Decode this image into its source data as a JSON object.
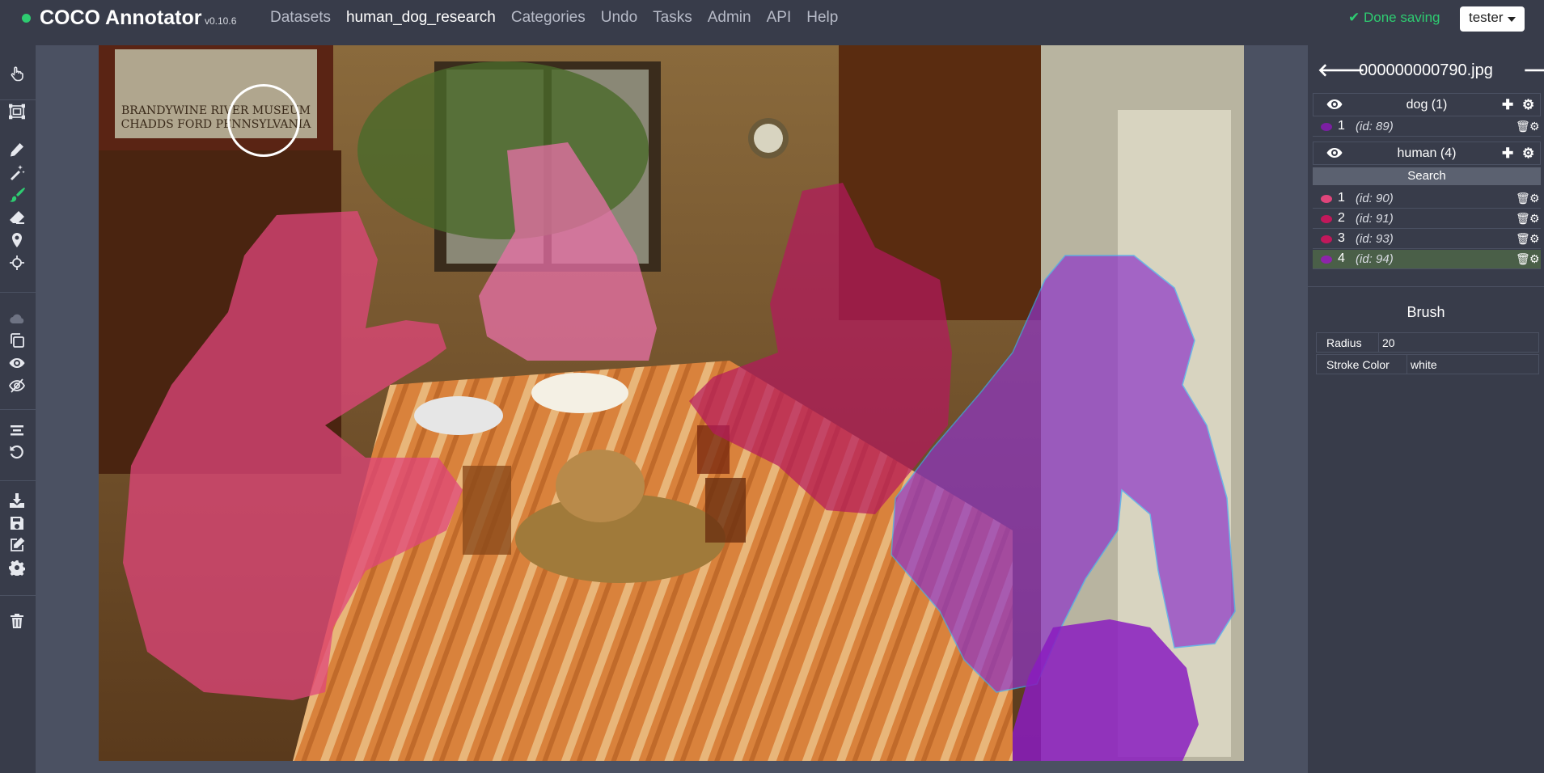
{
  "brand": {
    "name": "COCO Annotator",
    "version": "v0.10.6"
  },
  "nav": [
    "Datasets",
    "human_dog_research",
    "Categories",
    "Undo",
    "Tasks",
    "Admin",
    "API",
    "Help"
  ],
  "status": "✔ Done saving",
  "user": "tester",
  "toolbar": [
    "select-icon",
    "bbox-icon",
    "polygon-icon",
    "magic-wand-icon",
    "brush-icon",
    "eraser-icon",
    "keypoint-icon",
    "dextr-icon",
    "cloud-icon",
    "copy-icon",
    "show-all-icon",
    "hide-all-icon",
    "center-icon",
    "reset-icon",
    "download-icon",
    "save-icon",
    "edit-icon",
    "settings-icon",
    "delete-icon"
  ],
  "sidebar": {
    "file": "000000000790.jpg",
    "categories": [
      {
        "name": "dog (1)",
        "color": "#8e24aa",
        "annotations": [
          {
            "num": "1",
            "id": "(id: 89)",
            "color": "#9c27b0"
          }
        ]
      },
      {
        "name": "human (4)",
        "color": "#e91e63",
        "search": "Search",
        "annotations": [
          {
            "num": "1",
            "id": "(id: 90)",
            "color": "#e0457b"
          },
          {
            "num": "2",
            "id": "(id: 91)",
            "color": "#c2185b"
          },
          {
            "num": "3",
            "id": "(id: 93)",
            "color": "#c2185b"
          },
          {
            "num": "4",
            "id": "(id: 94)",
            "color": "#8e24aa"
          }
        ]
      }
    ],
    "tool_panel": {
      "title": "Brush",
      "radius_label": "Radius",
      "radius_value": "20",
      "stroke_label": "Stroke Color",
      "stroke_value": "white"
    }
  },
  "image": {
    "sign_line1": "BRANDYWINE RIVER MUSEUM",
    "sign_line2": "CHADDS FORD PENNSYLVANIA"
  }
}
